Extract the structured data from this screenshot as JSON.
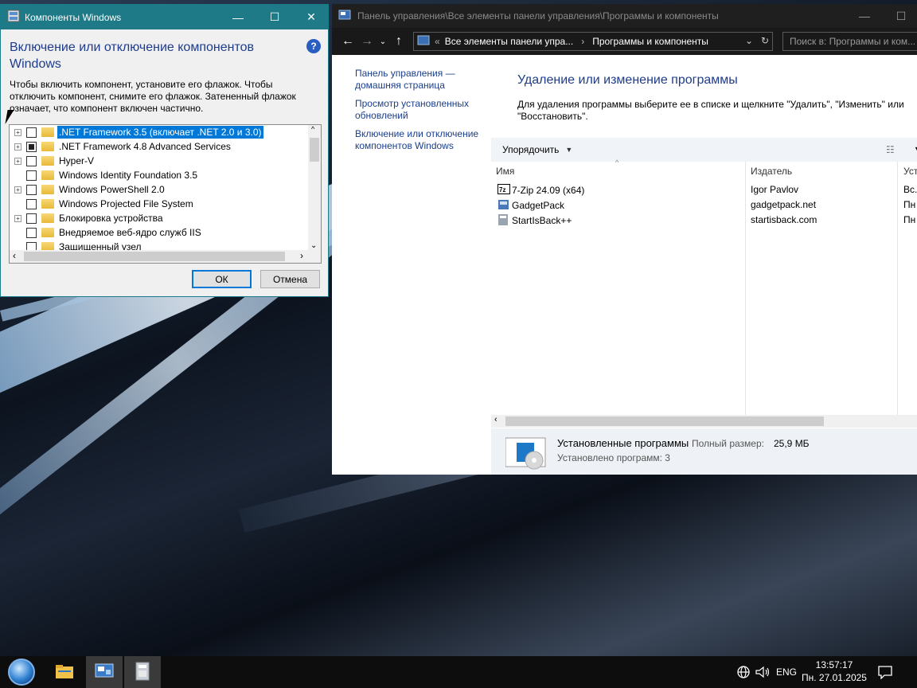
{
  "features_dialog": {
    "title": "Компоненты Windows",
    "heading": "Включение или отключение компонентов Windows",
    "help": "?",
    "description": "Чтобы включить компонент, установите его флажок. Чтобы отключить компонент, снимите его флажок. Затененный флажок означает, что компонент включен частично.",
    "items": [
      {
        "label": ".NET Framework 3.5 (включает .NET 2.0 и 3.0)",
        "expandable": true,
        "state": "unchecked",
        "selected": true
      },
      {
        "label": ".NET Framework 4.8 Advanced Services",
        "expandable": true,
        "state": "partial",
        "selected": false
      },
      {
        "label": "Hyper-V",
        "expandable": true,
        "state": "unchecked",
        "selected": false
      },
      {
        "label": "Windows Identity Foundation 3.5",
        "expandable": false,
        "state": "unchecked",
        "selected": false
      },
      {
        "label": "Windows PowerShell 2.0",
        "expandable": true,
        "state": "unchecked",
        "selected": false
      },
      {
        "label": "Windows Projected File System",
        "expandable": false,
        "state": "unchecked",
        "selected": false
      },
      {
        "label": "Блокировка устройства",
        "expandable": true,
        "state": "unchecked",
        "selected": false
      },
      {
        "label": "Внедряемое веб-ядро служб IIS",
        "expandable": false,
        "state": "unchecked",
        "selected": false
      },
      {
        "label": "Защищенный узел",
        "expandable": false,
        "state": "unchecked",
        "selected": false
      }
    ],
    "ok_label": "ОК",
    "cancel_label": "Отмена"
  },
  "control_panel": {
    "title": "Панель управления\\Все элементы панели управления\\Программы и компоненты",
    "address": {
      "overflow": "«",
      "seg1": "Все элементы панели упра...",
      "sep": "›",
      "seg2": "Программы и компоненты"
    },
    "search_placeholder": "Поиск в: Программы и ком...",
    "left_nav": [
      "Панель управления — домашняя страница",
      "Просмотр установленных обновлений",
      "Включение или отключение компонентов Windows"
    ],
    "heading": "Удаление или изменение программы",
    "description": "Для удаления программы выберите ее в списке и щелкните \"Удалить\", \"Изменить\" или \"Восстановить\".",
    "organize_label": "Упорядочить",
    "columns": {
      "name": "Имя",
      "publisher": "Издатель",
      "installed": "Уст"
    },
    "programs": [
      {
        "name": "7-Zip 24.09 (x64)",
        "publisher": "Igor Pavlov",
        "installed": "Вс."
      },
      {
        "name": "GadgetPack",
        "publisher": "gadgetpack.net",
        "installed": "Пн"
      },
      {
        "name": "StartIsBack++",
        "publisher": "startisback.com",
        "installed": "Пн"
      }
    ],
    "details": {
      "title": "Установленные программы",
      "size_label": "Полный размер:",
      "size_value": "25,9 МБ",
      "count": "Установлено программ: 3"
    }
  },
  "taskbar": {
    "lang": "ENG",
    "time": "13:57:17",
    "date": "Пн. 27.01.2025"
  }
}
